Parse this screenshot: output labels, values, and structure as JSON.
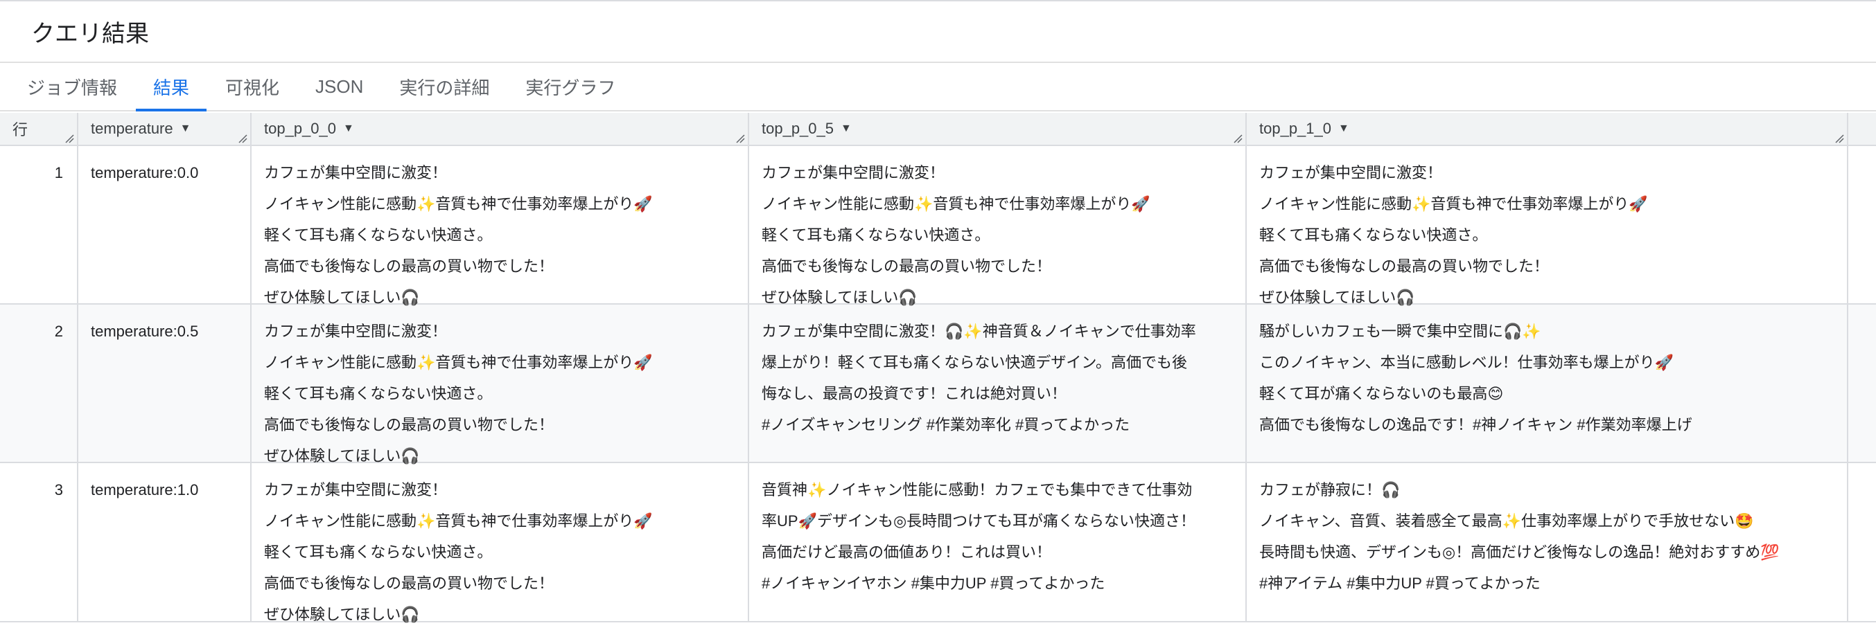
{
  "page": {
    "title": "クエリ結果"
  },
  "tabs": [
    {
      "label": "ジョブ情報"
    },
    {
      "label": "結果"
    },
    {
      "label": "可視化"
    },
    {
      "label": "JSON"
    },
    {
      "label": "実行の詳細"
    },
    {
      "label": "実行グラフ"
    }
  ],
  "active_tab": "結果",
  "columns": [
    {
      "label": "行"
    },
    {
      "label": "temperature"
    },
    {
      "label": "top_p_0_0"
    },
    {
      "label": "top_p_0_5"
    },
    {
      "label": "top_p_1_0"
    }
  ],
  "rows": [
    {
      "num": "1",
      "temperature": "temperature:0.0",
      "top_p_0_0": [
        "カフェが集中空間に激変！",
        "ノイキャン性能に感動✨音質も神で仕事効率爆上がり🚀",
        "軽くて耳も痛くならない快適さ。",
        "高価でも後悔なしの最高の買い物でした！",
        "ぜひ体験してほしい🎧"
      ],
      "top_p_0_5": [
        "カフェが集中空間に激変！",
        "ノイキャン性能に感動✨音質も神で仕事効率爆上がり🚀",
        "軽くて耳も痛くならない快適さ。",
        "高価でも後悔なしの最高の買い物でした！",
        "ぜひ体験してほしい🎧"
      ],
      "top_p_1_0": [
        "カフェが集中空間に激変！",
        "ノイキャン性能に感動✨音質も神で仕事効率爆上がり🚀",
        "軽くて耳も痛くならない快適さ。",
        "高価でも後悔なしの最高の買い物でした！",
        "ぜひ体験してほしい🎧"
      ]
    },
    {
      "num": "2",
      "temperature": "temperature:0.5",
      "top_p_0_0": [
        "カフェが集中空間に激変！",
        "ノイキャン性能に感動✨音質も神で仕事効率爆上がり🚀",
        "軽くて耳も痛くならない快適さ。",
        "高価でも後悔なしの最高の買い物でした！",
        "ぜひ体験してほしい🎧"
      ],
      "top_p_0_5": [
        "カフェが集中空間に激変！🎧✨神音質＆ノイキャンで仕事効率",
        "爆上がり！軽くて耳も痛くならない快適デザイン。高価でも後",
        "悔なし、最高の投資です！これは絶対買い！",
        "#ノイズキャンセリング #作業効率化 #買ってよかった"
      ],
      "top_p_1_0": [
        "騒がしいカフェも一瞬で集中空間に🎧✨",
        "このノイキャン、本当に感動レベル！仕事効率も爆上がり🚀",
        "軽くて耳が痛くならないのも最高😊",
        "高価でも後悔なしの逸品です！#神ノイキャン #作業効率爆上げ"
      ]
    },
    {
      "num": "3",
      "temperature": "temperature:1.0",
      "top_p_0_0": [
        "カフェが集中空間に激変！",
        "ノイキャン性能に感動✨音質も神で仕事効率爆上がり🚀",
        "軽くて耳も痛くならない快適さ。",
        "高価でも後悔なしの最高の買い物でした！",
        "ぜひ体験してほしい🎧"
      ],
      "top_p_0_5": [
        "音質神✨ノイキャン性能に感動！カフェでも集中できて仕事効",
        "率UP🚀デザインも◎長時間つけても耳が痛くならない快適さ！",
        "高価だけど最高の価値あり！これは買い！",
        "#ノイキャンイヤホン #集中力UP #買ってよかった"
      ],
      "top_p_1_0": [
        "カフェが静寂に！🎧",
        "ノイキャン、音質、装着感全て最高✨仕事効率爆上がりで手放せない🤩",
        "長時間も快適、デザインも◎！高価だけど後悔なしの逸品！絶対おすすめ💯",
        "#神アイテム #集中力UP #買ってよかった"
      ]
    }
  ]
}
